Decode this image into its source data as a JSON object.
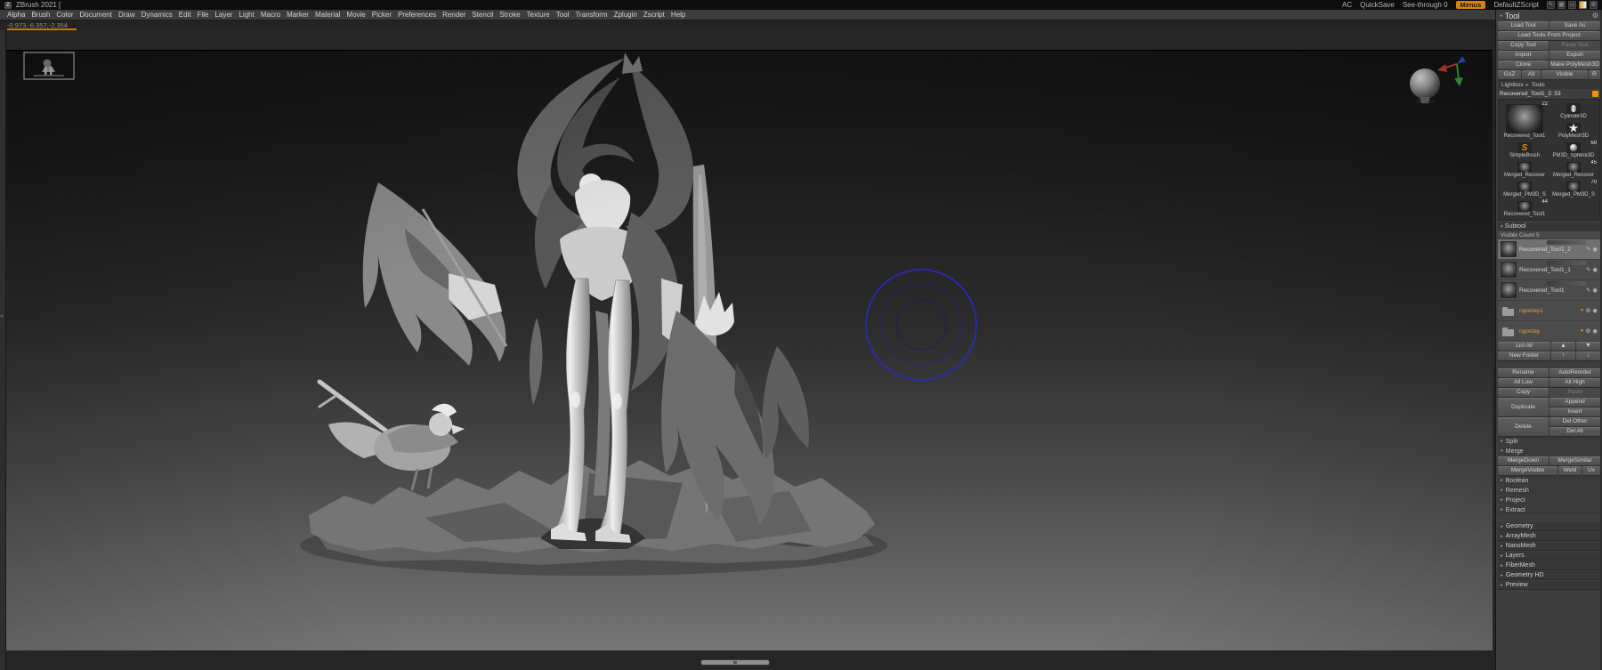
{
  "colors": {
    "accent_orange": "#e8920b",
    "menus_button": "#d4820a",
    "cursor_blue": "#2a2ac0",
    "folder_text": "#e0a13e",
    "axis_red": "#d84030",
    "axis_green": "#3fae3f",
    "axis_blue": "#3a52d8",
    "panel_bg": "#3e3e3e",
    "selected_row": "#707070"
  },
  "icons": {
    "gear": "⚙",
    "eye": "◉",
    "brush": "✎",
    "flame": "●",
    "arrow_up": "▲",
    "arrow_down": "▼",
    "folder_up": "↑",
    "folder_down": "↓",
    "collapsed": "▸",
    "expanded": "▾",
    "panel_left": "◂",
    "tray": "«",
    "pen": "✎",
    "grid": "▦",
    "monitor": "▭",
    "logo": "Z"
  },
  "titlebar": {
    "app_title": "ZBrush 2021 [",
    "ac": "AC",
    "quicksave": "QuickSave",
    "seethrough": "See-through 0",
    "menus": "Menus",
    "zscript": "DefaultZScript"
  },
  "menubar": {
    "items": [
      "Alpha",
      "Brush",
      "Color",
      "Document",
      "Draw",
      "Dynamics",
      "Edit",
      "File",
      "Layer",
      "Light",
      "Macro",
      "Marker",
      "Material",
      "Movie",
      "Picker",
      "Preferences",
      "Render",
      "Stencil",
      "Stroke",
      "Texture",
      "Tool",
      "Transform",
      "Zplugin",
      "Zscript",
      "Help"
    ]
  },
  "coords_readout": "-0.973,-6.357,-2.354",
  "tool_panel": {
    "title": "Tool",
    "load_tool": "Load Tool",
    "save_as": "Save As",
    "load_tools_from_project": "Load Tools From Project",
    "copy_tool": "Copy Tool",
    "paste_tool": "Paste Tool",
    "import": "Import",
    "export": "Export",
    "clone": "Clone",
    "make_polymesh3d": "Make PolyMesh3D",
    "goz": "GoZ",
    "all": "All",
    "visible": "Visible",
    "r": "R",
    "lightbox": "Lightbox",
    "lightbox_tools": "Tools",
    "active_tool": "Recovered_Tool1_2: 53",
    "tools": [
      {
        "name": "Recovered_Tool1",
        "count": "22",
        "kind": "sculpt",
        "size": "large"
      },
      {
        "name": "Cylinder3D",
        "count": "",
        "kind": "cylinder"
      },
      {
        "name": "PolyMesh3D",
        "count": "",
        "kind": "star"
      },
      {
        "name": "SimpleBrush",
        "count": "",
        "kind": "brush"
      },
      {
        "name": "PM3D_Sphere3D",
        "count": "69",
        "kind": "sphere"
      },
      {
        "name": "Merged_Recover",
        "count": "",
        "kind": "sculpt"
      },
      {
        "name": "Merged_Recover",
        "count": "45",
        "kind": "sculpt"
      },
      {
        "name": "Merged_PM3D_S",
        "count": "",
        "kind": "sculpt"
      },
      {
        "name": "Merged_PM3D_S",
        "count": "70",
        "kind": "sculpt"
      },
      {
        "name": "Recovered_Tool1",
        "count": "44",
        "kind": "sculpt"
      }
    ],
    "subtool": {
      "header": "Subtool",
      "visible_count": "Visible Count 5",
      "items": [
        {
          "name": "Recovered_Tool1_2",
          "type": "mesh",
          "selected": true
        },
        {
          "name": "Recovered_Tool1_1",
          "type": "mesh"
        },
        {
          "name": "Recovered_Tool1",
          "type": "mesh"
        },
        {
          "name": "ngontay1",
          "type": "folder"
        },
        {
          "name": "ngontay",
          "type": "folder"
        }
      ],
      "list_all": "List All",
      "new_folder": "New Folder",
      "rename": "Rename",
      "autoreorder": "AutoReorder",
      "all_low": "All Low",
      "all_high": "All High",
      "copy": "Copy",
      "paste": "Paste",
      "duplicate": "Duplicate",
      "append": "Append",
      "insert": "Insert",
      "delete": "Delete",
      "del_other": "Del Other",
      "del_all": "Del All",
      "split": "Split",
      "merge": "Merge",
      "merge_down": "MergeDown",
      "merge_similar": "MergeSimilar",
      "merge_visible": "MergeVisible",
      "weld": "Weld",
      "uv": "Uv",
      "boolean": "Boolean",
      "remesh": "Remesh",
      "project": "Project",
      "extract": "Extract"
    },
    "sections": [
      "Geometry",
      "ArrayMesh",
      "NanoMesh",
      "Layers",
      "FiberMesh",
      "Geometry HD",
      "Preview"
    ]
  }
}
